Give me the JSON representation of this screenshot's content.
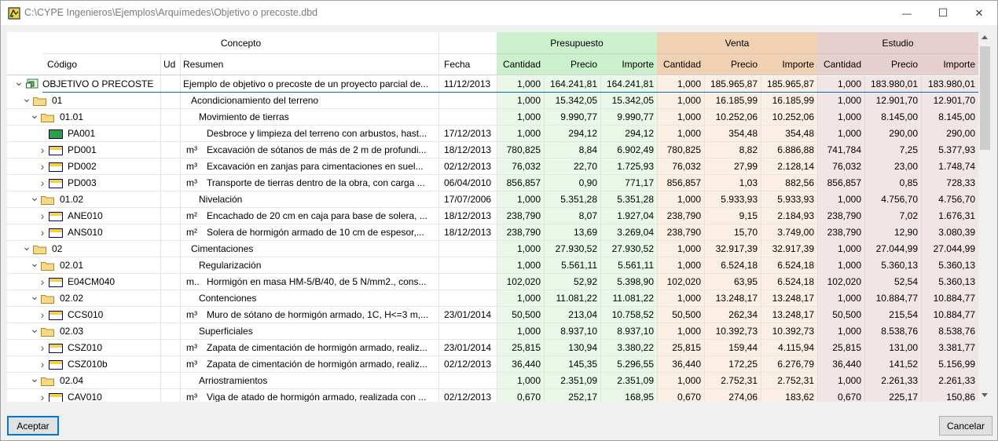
{
  "window": {
    "title": "C:\\CYPE Ingenieros\\Ejemplos\\Arquímedes\\Objetivo o precoste.dbd",
    "minimize_label": "—",
    "maximize_label": "☐",
    "close_label": "✕"
  },
  "headers": {
    "concepto": "Concepto",
    "codigo": "Código",
    "ud": "Ud",
    "resumen": "Resumen",
    "fecha": "Fecha",
    "presupuesto": "Presupuesto",
    "venta": "Venta",
    "estudio": "Estudio",
    "cantidad": "Cantidad",
    "precio": "Precio",
    "importe": "Importe"
  },
  "colors": {
    "presupuesto_header": "#ccefcc",
    "presupuesto_cell": "#e8f7e8",
    "venta_header": "#f0d1b3",
    "venta_cell": "#fbefe4",
    "estudio_header": "#e6cfcf",
    "estudio_cell": "#f1e5e5",
    "accent": "#0078d7"
  },
  "rows": [
    {
      "level": 0,
      "icon": "root",
      "chev": "v",
      "code": "OBJETIVO O PRECOSTE",
      "ud": "",
      "resumen": "Ejemplo de objetivo o precoste de un proyecto parcial de...",
      "fecha": "11/12/2013",
      "p_cant": "1,000",
      "p_prec": "164.241,81",
      "p_imp": "164.241,81",
      "v_cant": "1,000",
      "v_prec": "185.965,87",
      "v_imp": "185.965,87",
      "e_cant": "1,000",
      "e_prec": "183.980,01",
      "e_imp": "183.980,01"
    },
    {
      "level": 1,
      "icon": "folder",
      "chev": "v",
      "code": "01",
      "ud": "",
      "resumen": "Acondicionamiento del terreno",
      "fecha": "",
      "p_cant": "1,000",
      "p_prec": "15.342,05",
      "p_imp": "15.342,05",
      "v_cant": "1,000",
      "v_prec": "16.185,99",
      "v_imp": "16.185,99",
      "e_cant": "1,000",
      "e_prec": "12.901,70",
      "e_imp": "12.901,70"
    },
    {
      "level": 2,
      "icon": "folder",
      "chev": "v",
      "code": "01.01",
      "ud": "",
      "resumen": "Movimiento de tierras",
      "fecha": "",
      "p_cant": "1,000",
      "p_prec": "9.990,77",
      "p_imp": "9.990,77",
      "v_cant": "1,000",
      "v_prec": "10.252,06",
      "v_imp": "10.252,06",
      "e_cant": "1,000",
      "e_prec": "8.145,00",
      "e_imp": "8.145,00"
    },
    {
      "level": 3,
      "icon": "leaf-green",
      "chev": "",
      "code": "PA001",
      "ud": "",
      "resumen": "Desbroce y limpieza del terreno con arbustos, hast...",
      "fecha": "17/12/2013",
      "p_cant": "1,000",
      "p_prec": "294,12",
      "p_imp": "294,12",
      "v_cant": "1,000",
      "v_prec": "354,48",
      "v_imp": "354,48",
      "e_cant": "1,000",
      "e_prec": "290,00",
      "e_imp": "290,00"
    },
    {
      "level": 3,
      "icon": "leaf",
      "chev": ">",
      "code": "PD001",
      "ud": "m³",
      "resumen": "Excavación de sótanos de más de 2 m de profundi...",
      "fecha": "18/12/2013",
      "p_cant": "780,825",
      "p_prec": "8,84",
      "p_imp": "6.902,49",
      "v_cant": "780,825",
      "v_prec": "8,82",
      "v_imp": "6.886,88",
      "e_cant": "741,784",
      "e_prec": "7,25",
      "e_imp": "5.377,93"
    },
    {
      "level": 3,
      "icon": "leaf",
      "chev": ">",
      "code": "PD002",
      "ud": "m³",
      "resumen": "Excavación en zanjas para cimentaciones en suel...",
      "fecha": "02/12/2013",
      "p_cant": "76,032",
      "p_prec": "22,70",
      "p_imp": "1.725,93",
      "v_cant": "76,032",
      "v_prec": "27,99",
      "v_imp": "2.128,14",
      "e_cant": "76,032",
      "e_prec": "23,00",
      "e_imp": "1.748,74"
    },
    {
      "level": 3,
      "icon": "leaf",
      "chev": ">",
      "code": "PD003",
      "ud": "m³",
      "resumen": "Transporte de tierras dentro de la obra, con carga ...",
      "fecha": "06/04/2010",
      "p_cant": "856,857",
      "p_prec": "0,90",
      "p_imp": "771,17",
      "v_cant": "856,857",
      "v_prec": "1,03",
      "v_imp": "882,56",
      "e_cant": "856,857",
      "e_prec": "0,85",
      "e_imp": "728,33"
    },
    {
      "level": 2,
      "icon": "folder",
      "chev": "v",
      "code": "01.02",
      "ud": "",
      "resumen": "Nivelación",
      "fecha": "17/07/2006",
      "p_cant": "1,000",
      "p_prec": "5.351,28",
      "p_imp": "5.351,28",
      "v_cant": "1,000",
      "v_prec": "5.933,93",
      "v_imp": "5.933,93",
      "e_cant": "1,000",
      "e_prec": "4.756,70",
      "e_imp": "4.756,70"
    },
    {
      "level": 3,
      "icon": "leaf",
      "chev": ">",
      "code": "ANE010",
      "ud": "m²",
      "resumen": "Encachado de 20 cm en caja para base de solera, ...",
      "fecha": "18/12/2013",
      "p_cant": "238,790",
      "p_prec": "8,07",
      "p_imp": "1.927,04",
      "v_cant": "238,790",
      "v_prec": "9,15",
      "v_imp": "2.184,93",
      "e_cant": "238,790",
      "e_prec": "7,02",
      "e_imp": "1.676,31"
    },
    {
      "level": 3,
      "icon": "leaf",
      "chev": ">",
      "code": "ANS010",
      "ud": "m²",
      "resumen": "Solera de hormigón armado de 10 cm de espesor,...",
      "fecha": "18/12/2013",
      "p_cant": "238,790",
      "p_prec": "13,69",
      "p_imp": "3.269,04",
      "v_cant": "238,790",
      "v_prec": "15,70",
      "v_imp": "3.749,00",
      "e_cant": "238,790",
      "e_prec": "12,90",
      "e_imp": "3.080,39"
    },
    {
      "level": 1,
      "icon": "folder",
      "chev": "v",
      "code": "02",
      "ud": "",
      "resumen": "Cimentaciones",
      "fecha": "",
      "p_cant": "1,000",
      "p_prec": "27.930,52",
      "p_imp": "27.930,52",
      "v_cant": "1,000",
      "v_prec": "32.917,39",
      "v_imp": "32.917,39",
      "e_cant": "1,000",
      "e_prec": "27.044,99",
      "e_imp": "27.044,99"
    },
    {
      "level": 2,
      "icon": "folder",
      "chev": "v",
      "code": "02.01",
      "ud": "",
      "resumen": "Regularización",
      "fecha": "",
      "p_cant": "1,000",
      "p_prec": "5.561,11",
      "p_imp": "5.561,11",
      "v_cant": "1,000",
      "v_prec": "6.524,18",
      "v_imp": "6.524,18",
      "e_cant": "1,000",
      "e_prec": "5.360,13",
      "e_imp": "5.360,13"
    },
    {
      "level": 3,
      "icon": "leaf",
      "chev": ">",
      "code": "E04CM040",
      "ud": "m..",
      "resumen": "Hormigón en masa HM-5/B/40, de 5 N/mm2., cons...",
      "fecha": "",
      "p_cant": "102,020",
      "p_prec": "52,92",
      "p_imp": "5.398,90",
      "v_cant": "102,020",
      "v_prec": "63,95",
      "v_imp": "6.524,18",
      "e_cant": "102,020",
      "e_prec": "52,54",
      "e_imp": "5.360,13"
    },
    {
      "level": 2,
      "icon": "folder",
      "chev": "v",
      "code": "02.02",
      "ud": "",
      "resumen": "Contenciones",
      "fecha": "",
      "p_cant": "1,000",
      "p_prec": "11.081,22",
      "p_imp": "11.081,22",
      "v_cant": "1,000",
      "v_prec": "13.248,17",
      "v_imp": "13.248,17",
      "e_cant": "1,000",
      "e_prec": "10.884,77",
      "e_imp": "10.884,77"
    },
    {
      "level": 3,
      "icon": "leaf",
      "chev": ">",
      "code": "CCS010",
      "ud": "m³",
      "resumen": "Muro de sótano de hormigón armado, 1C, H<=3 m,...",
      "fecha": "23/01/2014",
      "p_cant": "50,500",
      "p_prec": "213,04",
      "p_imp": "10.758,52",
      "v_cant": "50,500",
      "v_prec": "262,34",
      "v_imp": "13.248,17",
      "e_cant": "50,500",
      "e_prec": "215,54",
      "e_imp": "10.884,77"
    },
    {
      "level": 2,
      "icon": "folder",
      "chev": "v",
      "code": "02.03",
      "ud": "",
      "resumen": "Superficiales",
      "fecha": "",
      "p_cant": "1,000",
      "p_prec": "8.937,10",
      "p_imp": "8.937,10",
      "v_cant": "1,000",
      "v_prec": "10.392,73",
      "v_imp": "10.392,73",
      "e_cant": "1,000",
      "e_prec": "8.538,76",
      "e_imp": "8.538,76"
    },
    {
      "level": 3,
      "icon": "leaf",
      "chev": ">",
      "code": "CSZ010",
      "ud": "m³",
      "resumen": "Zapata de cimentación de hormigón armado, realiz...",
      "fecha": "23/01/2014",
      "p_cant": "25,815",
      "p_prec": "130,94",
      "p_imp": "3.380,22",
      "v_cant": "25,815",
      "v_prec": "159,44",
      "v_imp": "4.115,94",
      "e_cant": "25,815",
      "e_prec": "131,00",
      "e_imp": "3.381,77"
    },
    {
      "level": 3,
      "icon": "leaf",
      "chev": ">",
      "code": "CSZ010b",
      "ud": "m³",
      "resumen": "Zapata de cimentación de hormigón armado, realiz...",
      "fecha": "02/12/2013",
      "p_cant": "36,440",
      "p_prec": "145,35",
      "p_imp": "5.296,55",
      "v_cant": "36,440",
      "v_prec": "172,25",
      "v_imp": "6.276,79",
      "e_cant": "36,440",
      "e_prec": "141,52",
      "e_imp": "5.156,99"
    },
    {
      "level": 2,
      "icon": "folder",
      "chev": "v",
      "code": "02.04",
      "ud": "",
      "resumen": "Arriostramientos",
      "fecha": "",
      "p_cant": "1,000",
      "p_prec": "2.351,09",
      "p_imp": "2.351,09",
      "v_cant": "1,000",
      "v_prec": "2.752,31",
      "v_imp": "2.752,31",
      "e_cant": "1,000",
      "e_prec": "2.261,33",
      "e_imp": "2.261,33"
    },
    {
      "level": 3,
      "icon": "leaf",
      "chev": ">",
      "code": "CAV010",
      "ud": "m³",
      "resumen": "Viga de atado de hormigón armado, realizada con ...",
      "fecha": "02/12/2013",
      "p_cant": "0,670",
      "p_prec": "252,17",
      "p_imp": "168,95",
      "v_cant": "0,670",
      "v_prec": "274,06",
      "v_imp": "183,62",
      "e_cant": "0,670",
      "e_prec": "225,17",
      "e_imp": "150,86"
    }
  ],
  "buttons": {
    "accept": "Aceptar",
    "cancel": "Cancelar"
  }
}
